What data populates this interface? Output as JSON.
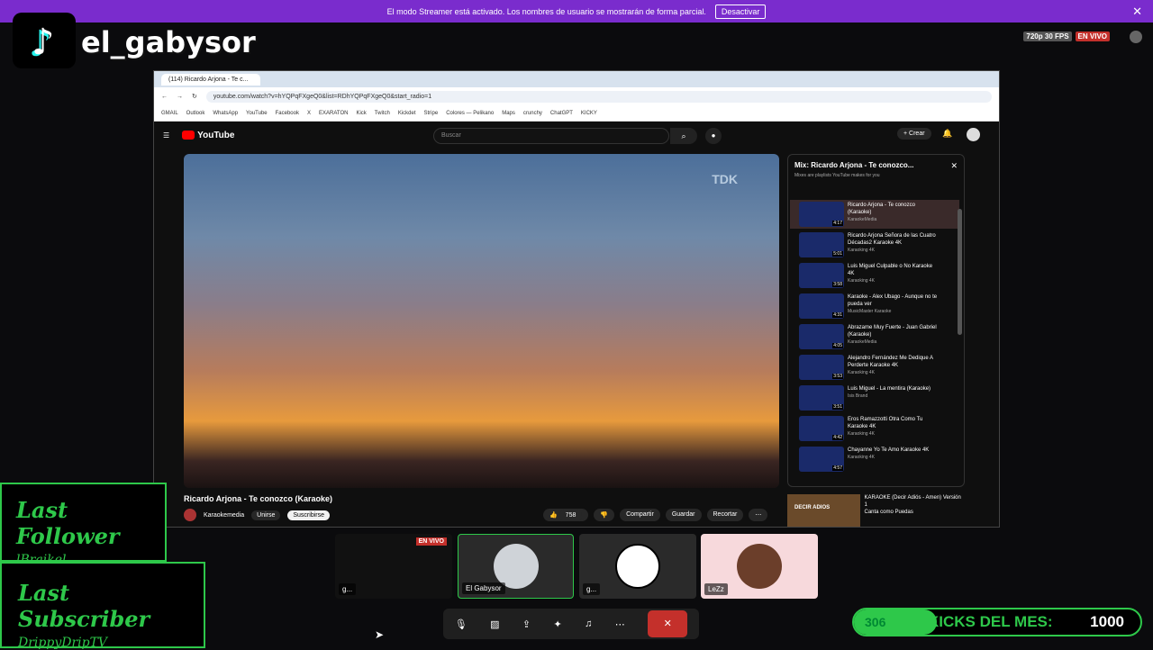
{
  "banner": {
    "text": "El modo Streamer está activado. Los nombres de usuario se mostrarán de forma parcial.",
    "button": "Desactivar"
  },
  "channel": {
    "name": "el_gabysor"
  },
  "status": {
    "quality": "720p 30 FPS",
    "live": "EN VIVO"
  },
  "browser": {
    "tab": "(114) Ricardo Arjona - Te c...",
    "url": "youtube.com/watch?v=hYQPqFXgeQ0&list=RDhYQPqFXgeQ0&start_radio=1",
    "bookmarks": [
      "GMAIL",
      "Outlook",
      "WhatsApp",
      "YouTube",
      "Facebook",
      "X",
      "EXARATON",
      "Kick",
      "Twitch",
      "Kickdet",
      "Stripe",
      "Colores — Pelikano",
      "Maps",
      "crunchy",
      "ChatGPT",
      "KICKY"
    ]
  },
  "youtube": {
    "logo": "YouTube",
    "search_placeholder": "Buscar",
    "create": "Crear",
    "video_logo": "TDK",
    "title": "Ricardo Arjona - Te conozco (Karaoke)",
    "channel": "Karaokemedia",
    "join": "Unirse",
    "subscribe": "Suscribirse",
    "likes": "758",
    "share": "Compartir",
    "save": "Guardar",
    "clip": "Recortar"
  },
  "playlist": {
    "title": "Mix: Ricardo Arjona - Te conozco...",
    "subtitle": "Mixes are playlists YouTube makes for you",
    "items": [
      {
        "title": "Ricardo Arjona - Te conozco (Karaoke)",
        "channel": "KaraokeMedia",
        "duration": "4:17"
      },
      {
        "title": "Ricardo Arjona Señora de las Cuatro Décadas2 Karaoke 4K",
        "channel": "Karaoking 4K",
        "duration": "5:01"
      },
      {
        "title": "Luis Miguel Culpable o No Karaoke 4K",
        "channel": "Karaoking 4K",
        "duration": "3:58"
      },
      {
        "title": "Karaoke - Alex Ubago - Aunque no te pueda ver",
        "channel": "MusicMaster Karaoke",
        "duration": "4:31"
      },
      {
        "title": "Abrazame Muy Fuerte - Juan Gabriel (Karaoke)",
        "channel": "KaraokeMedia",
        "duration": "4:05"
      },
      {
        "title": "Alejandro Fernández Me Dedique A Perderte Karaoke 4K",
        "channel": "Karaoking 4K",
        "duration": "3:53"
      },
      {
        "title": "Luis Miguel - La mentira (Karaoke)",
        "channel": "Isis Brand",
        "duration": "3:51"
      },
      {
        "title": "Eros Ramazzotti Otra Como Tu Karaoke 4K",
        "channel": "Karaoking 4K",
        "duration": "4:42"
      },
      {
        "title": "Chayanne Yo Te Amo Karaoke 4K",
        "channel": "Karaoking 4K",
        "duration": "4:57"
      }
    ]
  },
  "recommended": {
    "thumb": "DECIR ADIOS",
    "title": "KARAOKE (Decir Adiós - Amen) Versión 1",
    "channel": "Canta como Puedas"
  },
  "last_follower": {
    "label": "Last Follower",
    "name": "lBraikel"
  },
  "last_subscriber": {
    "label": "Last Subscriber",
    "name": "DrippyDripTV"
  },
  "participants": [
    {
      "name": "g..."
    },
    {
      "name": "El Gabysor"
    },
    {
      "name": "g..."
    },
    {
      "name": "LeZz"
    }
  ],
  "screen_live": "EN VIVO",
  "kicks": {
    "value": "306",
    "label": "KICKS DEL MES:",
    "goal": "1000"
  },
  "colors": {
    "accent": "#2ec84a",
    "banner": "#7a2ccd",
    "live": "#c4302b"
  }
}
